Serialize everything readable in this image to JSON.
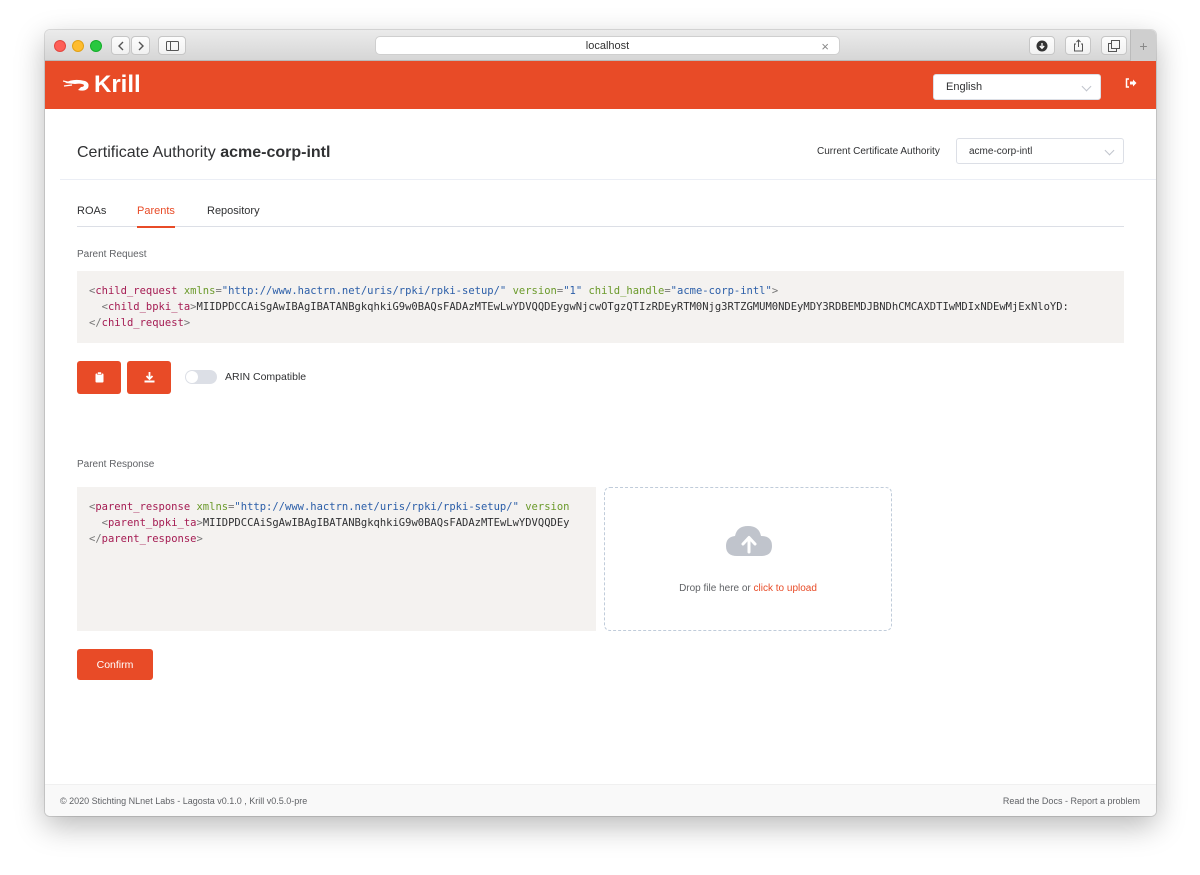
{
  "browser": {
    "address": "localhost"
  },
  "header": {
    "logo_text": "Krill",
    "language": "English"
  },
  "page": {
    "title_prefix": "Certificate Authority",
    "title_ca": "acme-corp-intl",
    "current_ca_label": "Current Certificate Authority",
    "current_ca_value": "acme-corp-intl"
  },
  "tabs": [
    {
      "label": "ROAs"
    },
    {
      "label": "Parents"
    },
    {
      "label": "Repository"
    }
  ],
  "request": {
    "label": "Parent Request",
    "open_tag": "child_request",
    "xmlns_attr": "xmlns",
    "xmlns_value": "\"http://www.hactrn.net/uris/rpki/rpki-setup/\"",
    "version_attr": "version",
    "version_value": "\"1\"",
    "handle_attr": "child_handle",
    "handle_value": "\"acme-corp-intl\"",
    "bpki_tag": "child_bpki_ta",
    "bpki_value": "MIIDPDCCAiSgAwIBAgIBATANBgkqhkiG9w0BAQsFADAzMTEwLwYDVQQDEygwNjcwOTgzQTIzRDEyRTM0Njg3RTZGMUM0NDEyMDY3RDBEMDJBNDhCMCAXDTIwMDIxNDEwMjExNloYD:",
    "close_tag": "child_request",
    "arin_label": "ARIN Compatible"
  },
  "response": {
    "label": "Parent Response",
    "open_tag": "parent_response",
    "xmlns_attr": "xmlns",
    "xmlns_value": "\"http://www.hactrn.net/uris/rpki/rpki-setup/\"",
    "version_attr": "version",
    "bpki_tag": "parent_bpki_ta",
    "bpki_value": "MIIDPDCCAiSgAwIBAgIBATANBgkqhkiG9w0BAQsFADAzMTEwLwYDVQQDEy",
    "close_tag": "parent_response",
    "upload_text": "Drop file here or",
    "upload_link": "click to upload",
    "confirm_label": "Confirm"
  },
  "footer": {
    "left": "© 2020 Stichting NLnet Labs - Lagosta v0.1.0 , Krill v0.5.0-pre",
    "docs": "Read the Docs",
    "sep": " - ",
    "report": "Report a problem"
  },
  "icons": {
    "copy": "clipboard-icon",
    "download": "download-icon",
    "upload": "cloud-upload-icon",
    "logout": "logout-icon"
  },
  "colors": {
    "brand": "#e84b27",
    "code_bg": "#f4f2f0",
    "tag": "#a51c53",
    "attr": "#6b9a2b",
    "string": "#2b5ea8"
  }
}
